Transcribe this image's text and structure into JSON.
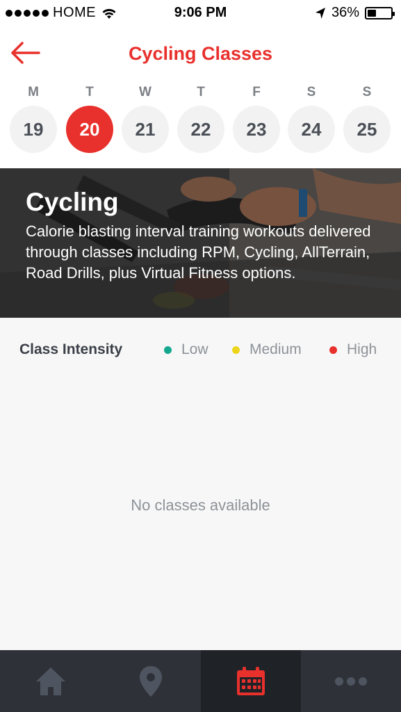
{
  "status_bar": {
    "carrier": "HOME",
    "time": "9:06 PM",
    "battery": "36%"
  },
  "header": {
    "title": "Cycling Classes",
    "back_icon": "arrow-left-icon",
    "accent_color": "#e8302c"
  },
  "week": {
    "selected_index": 1,
    "days": [
      {
        "letter": "M",
        "date": "19"
      },
      {
        "letter": "T",
        "date": "20"
      },
      {
        "letter": "W",
        "date": "21"
      },
      {
        "letter": "T",
        "date": "22"
      },
      {
        "letter": "F",
        "date": "23"
      },
      {
        "letter": "S",
        "date": "24"
      },
      {
        "letter": "S",
        "date": "25"
      }
    ]
  },
  "hero": {
    "title": "Cycling",
    "description": "Calorie blasting interval training workouts delivered through classes including RPM, Cycling, AllTerrain, Road Drills, plus Virtual Fitness options."
  },
  "intensity": {
    "label": "Class Intensity",
    "levels": [
      {
        "label": "Low",
        "color": "#13a88f"
      },
      {
        "label": "Medium",
        "color": "#ecd51b"
      },
      {
        "label": "High",
        "color": "#e8302c"
      }
    ]
  },
  "empty_message": "No classes available",
  "tabbar": {
    "active_index": 2,
    "tabs": [
      {
        "icon": "home-icon"
      },
      {
        "icon": "location-pin-icon"
      },
      {
        "icon": "calendar-icon"
      },
      {
        "icon": "more-icon"
      }
    ]
  }
}
